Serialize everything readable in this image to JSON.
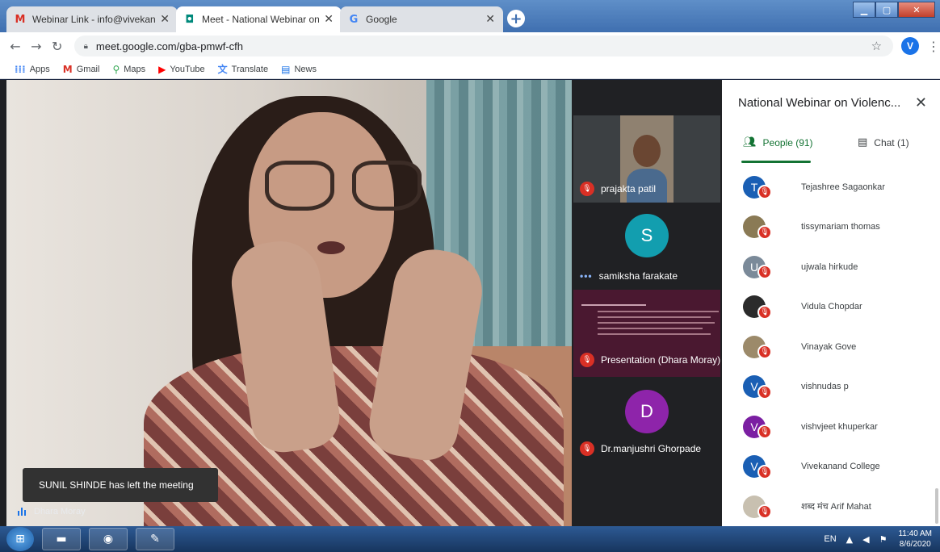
{
  "browser": {
    "tabs": [
      {
        "label": "Webinar Link - info@vivekanand",
        "icon": "gmail-icon",
        "active": false
      },
      {
        "label": "Meet - National Webinar on Viol",
        "icon": "meet-icon",
        "active": true
      },
      {
        "label": "Google",
        "icon": "google-icon",
        "active": false
      }
    ],
    "new_tab": "+",
    "url": "meet.google.com/gba-pmwf-cfh",
    "profile_initial": "V",
    "bookmarks": [
      {
        "label": "Apps",
        "icon": "apps-grid-icon"
      },
      {
        "label": "Gmail",
        "icon": "gmail-icon"
      },
      {
        "label": "Maps",
        "icon": "maps-pin-icon"
      },
      {
        "label": "YouTube",
        "icon": "youtube-icon"
      },
      {
        "label": "Translate",
        "icon": "translate-icon"
      },
      {
        "label": "News",
        "icon": "news-icon"
      }
    ]
  },
  "meet": {
    "main_speaker": "Dhara Moray",
    "toast": "SUNIL SHINDE has left the meeting",
    "tiles": [
      {
        "name": "prajakta patil",
        "muted": true,
        "kind": "video"
      },
      {
        "name": "samiksha farakate",
        "initial": "S",
        "color": "#129eaf",
        "muted": false,
        "kind": "avatar"
      },
      {
        "name": "Presentation (Dhara Moray)",
        "muted": true,
        "kind": "presentation"
      },
      {
        "name": "Dr.manjushri Ghorpade",
        "initial": "D",
        "color": "#8e24aa",
        "muted": true,
        "kind": "avatar"
      }
    ]
  },
  "panel": {
    "title": "National Webinar on Violenc...",
    "tabs": [
      {
        "label": "People (91)",
        "active": true
      },
      {
        "label": "Chat (1)",
        "active": false
      }
    ],
    "people": [
      {
        "name": "Tejashree Sagaonkar",
        "initial": "T",
        "color": "#1a5fb4"
      },
      {
        "name": "tissymariam thomas",
        "initial": "",
        "color": "#8a7a55"
      },
      {
        "name": "ujwala hirkude",
        "initial": "U",
        "color": "#7b8a99"
      },
      {
        "name": "Vidula Chopdar",
        "initial": "",
        "color": "#2b2b2b"
      },
      {
        "name": "Vinayak Gove",
        "initial": "",
        "color": "#9c8a6a"
      },
      {
        "name": "vishnudas p",
        "initial": "V",
        "color": "#1a5fb4"
      },
      {
        "name": "vishvjeet khuperkar",
        "initial": "V",
        "color": "#7b1fa2"
      },
      {
        "name": "Vivekanand College",
        "initial": "V",
        "color": "#1a5fb4"
      },
      {
        "name": "शब्द मंच Arif Mahat",
        "initial": "",
        "color": "#c8c0b0"
      }
    ]
  },
  "taskbar": {
    "language": "EN",
    "time": "11:40 AM",
    "date": "8/6/2020"
  },
  "colors": {
    "accent_green": "#137333",
    "mute_red": "#d93025",
    "meet_dark": "#202124"
  }
}
